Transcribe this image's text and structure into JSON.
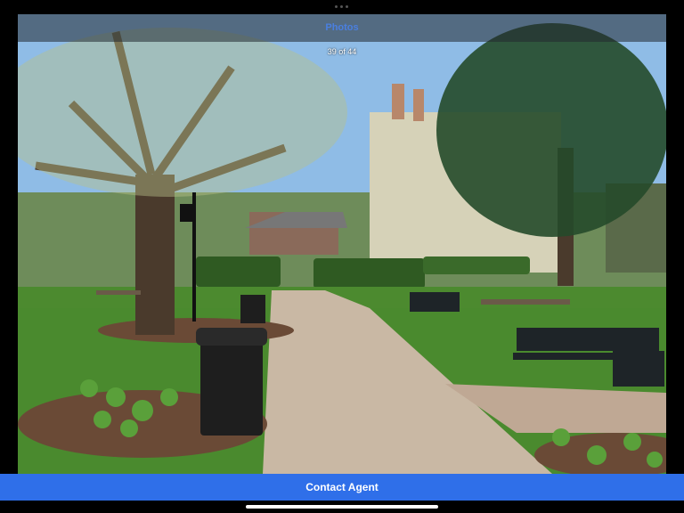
{
  "viewer": {
    "title": "Photos",
    "counter": "39 of 44"
  },
  "footer": {
    "cta_label": "Contact Agent"
  },
  "colors": {
    "accent": "#2f6fe9",
    "title": "#4a7fe0",
    "background": "#000000"
  },
  "icons": {
    "home_indicator": "home-indicator-bar"
  }
}
